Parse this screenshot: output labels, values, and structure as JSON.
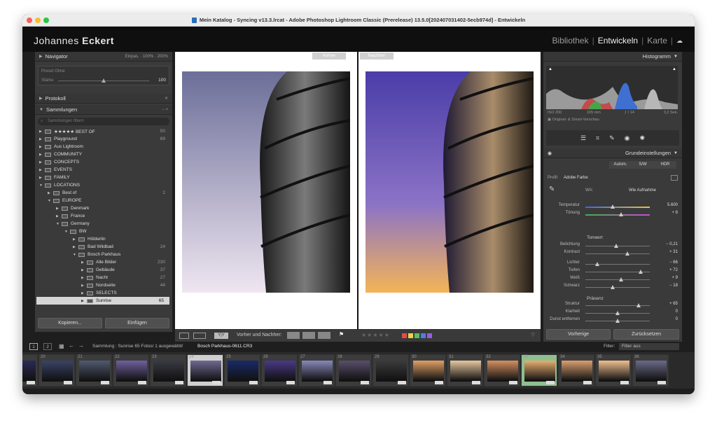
{
  "window": {
    "title": "Mein Katalog - Syncing v13.3.lrcat - Adobe Photoshop Lightroom Classic (Prerelease) 13.5.0[202407031402-5ecb974d] - Entwickeln"
  },
  "identity": {
    "first": "Johannes",
    "last": "Eckert",
    "modules": [
      "Bibliothek",
      "Entwickeln",
      "Karte"
    ],
    "active_module": "Entwickeln"
  },
  "left": {
    "navigator": {
      "label": "Navigator",
      "zoom": [
        "Einpas.",
        "100%",
        "200%"
      ]
    },
    "preset": {
      "label": "Preset",
      "value": "Ohne",
      "amount_label": "Stärke",
      "amount": "100"
    },
    "history": {
      "label": "Protokoll"
    },
    "collections": {
      "label": "Sammlungen",
      "filter_placeholder": "Sammlungen filtern",
      "items": [
        {
          "name": "★★★★★ BEST OF",
          "count": "50"
        },
        {
          "name": "Playground",
          "count": "69"
        },
        {
          "name": "Aus Lightroom",
          "count": ""
        },
        {
          "name": "COMMUNITY",
          "count": ""
        },
        {
          "name": "CONCEPTS",
          "count": ""
        },
        {
          "name": "EVENTS",
          "count": ""
        },
        {
          "name": "FAMILY",
          "count": ""
        },
        {
          "name": "LOCATIONS",
          "count": ""
        },
        {
          "name": "Best of",
          "count": "2"
        },
        {
          "name": "EUROPE",
          "count": ""
        },
        {
          "name": "Denmark",
          "count": ""
        },
        {
          "name": "France",
          "count": ""
        },
        {
          "name": "Germany",
          "count": ""
        },
        {
          "name": "BW",
          "count": ""
        },
        {
          "name": "Hölderlin",
          "count": ""
        },
        {
          "name": "Bad Wildbad",
          "count": "24"
        },
        {
          "name": "Bosch Parkhaus",
          "count": ""
        },
        {
          "name": "Alle Bilder",
          "count": "230"
        },
        {
          "name": "Gebäude",
          "count": "37"
        },
        {
          "name": "Nacht",
          "count": "27"
        },
        {
          "name": "Nordseite",
          "count": "44"
        },
        {
          "name": "SELECTS",
          "count": ""
        },
        {
          "name": "Sunrise",
          "count": "65"
        }
      ]
    },
    "copy_button": "Kopieren...",
    "paste_button": "Einfügen"
  },
  "center": {
    "before_label": "Vorher",
    "after_label": "Nachher",
    "toolbar_text": "Vorher und Nachher:"
  },
  "right": {
    "histogram": {
      "label": "Histogramm",
      "iso": "ISO 200",
      "focal": "105 mm",
      "aperture": "ƒ / 14",
      "shutter": "3,2 Sek.",
      "preview": "Original- & Smart-Vorschau"
    },
    "basic": {
      "label": "Grundeinstellungen",
      "modes": [
        "Autom.",
        "S/W",
        "HDR"
      ],
      "profile_label": "Profil:",
      "profile_value": "Adobe Farbe",
      "wb_label": "WA:",
      "wb_value": "Wie Aufnahme",
      "tone_label": "Tonwert",
      "presence_label": "Präsenz",
      "sliders": [
        {
          "label": "Temperatur",
          "value": "5.600",
          "pos": 0.42
        },
        {
          "label": "Tönung",
          "value": "+ 8",
          "pos": 0.55
        },
        {
          "label": "Belichtung",
          "value": "− 0,21",
          "pos": 0.48
        },
        {
          "label": "Kontrast",
          "value": "+ 31",
          "pos": 0.65
        },
        {
          "label": "Lichter",
          "value": "− 66",
          "pos": 0.18
        },
        {
          "label": "Tiefen",
          "value": "+ 72",
          "pos": 0.86
        },
        {
          "label": "Weiß",
          "value": "+ 9",
          "pos": 0.55
        },
        {
          "label": "Schwarz",
          "value": "− 18",
          "pos": 0.42
        },
        {
          "label": "Struktur",
          "value": "+ 65",
          "pos": 0.83
        },
        {
          "label": "Klarheit",
          "value": "0",
          "pos": 0.5
        },
        {
          "label": "Dunst entfernen",
          "value": "0",
          "pos": 0.5
        }
      ]
    },
    "prev_button": "Vorherige",
    "reset_button": "Zurücksetzen"
  },
  "filmstrip": {
    "pages": [
      "1",
      "2"
    ],
    "path": "Sammlung : Sunrise   65 Fotos/ 1 ausgewählt/",
    "file": "Bosch Parkhaus-0611.CR3",
    "filter_label": "Filter:",
    "filter_value": "Filter aus",
    "numbers": [
      "",
      "20",
      "21",
      "22",
      "23",
      "24",
      "25",
      "26",
      "27",
      "28",
      "29",
      "30",
      "31",
      "32",
      "33",
      "34",
      "35",
      "36"
    ]
  },
  "colors": {
    "accent": "#e6e6e6",
    "panel": "#3a3a3a",
    "selected_thumb": "#8fbf8f"
  }
}
